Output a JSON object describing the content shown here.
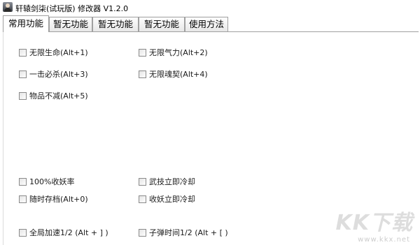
{
  "window": {
    "title": "轩辕剑柒(试玩版) 修改器  V1.2.0"
  },
  "tabs": [
    {
      "label": "常用功能",
      "active": true
    },
    {
      "label": "暂无功能",
      "active": false
    },
    {
      "label": "暂无功能",
      "active": false
    },
    {
      "label": "暂无功能",
      "active": false
    },
    {
      "label": "使用方法",
      "active": false
    }
  ],
  "options": {
    "infinite_health": {
      "label": "无限生命(Alt+1)",
      "checked": false
    },
    "infinite_qi": {
      "label": "无限气力(Alt+2)",
      "checked": false
    },
    "one_hit_kill": {
      "label": "一击必杀(Alt+3)",
      "checked": false
    },
    "infinite_soul": {
      "label": "无限魂契(Alt+4)",
      "checked": false
    },
    "items_no_decrease": {
      "label": "物品不减(Alt+5)",
      "checked": false
    },
    "capture_rate": {
      "label": "100%收妖率",
      "checked": false
    },
    "skill_instant_cooldown": {
      "label": "武技立即冷却",
      "checked": false
    },
    "save_anytime": {
      "label": "随时存档(Alt+0)",
      "checked": false
    },
    "capture_instant_cooldown": {
      "label": "收妖立即冷却",
      "checked": false
    },
    "global_speed": {
      "label": "全局加速1/2 (Alt + ] )",
      "checked": false
    },
    "bullet_time": {
      "label": "子弹时间1/2 (Alt + [ )",
      "checked": false
    }
  },
  "watermark": {
    "logo": "KK下载",
    "url": "www.kkx.net"
  }
}
